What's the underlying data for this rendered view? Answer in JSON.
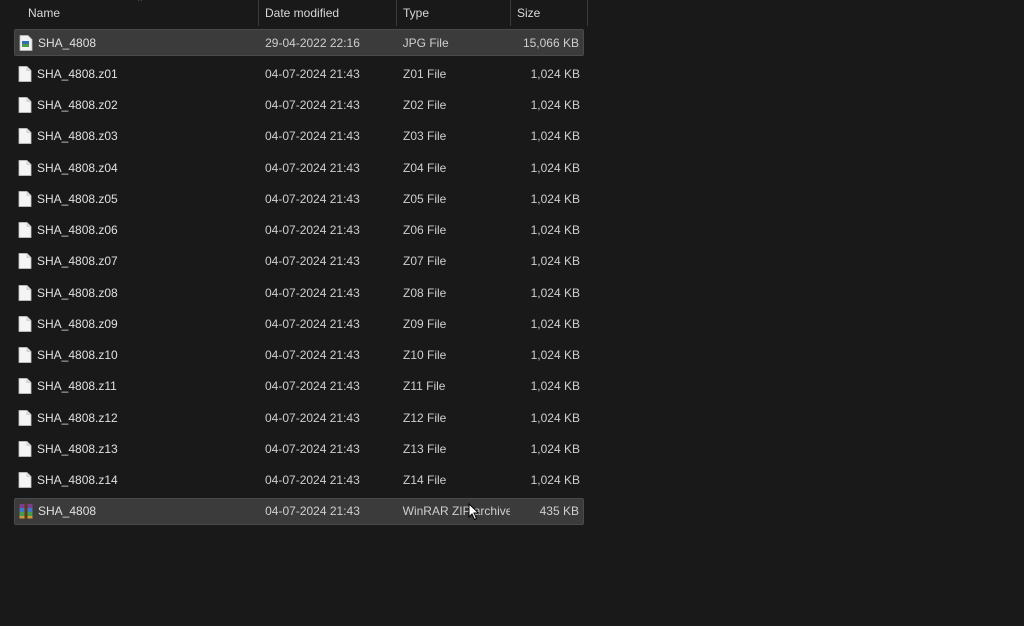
{
  "columns": {
    "name": "Name",
    "date": "Date modified",
    "type": "Type",
    "size": "Size"
  },
  "files": [
    {
      "name": "SHA_4808",
      "date": "29-04-2022 22:16",
      "type": "JPG File",
      "size": "15,066 KB",
      "icon": "image-file-icon",
      "selected": true
    },
    {
      "name": "SHA_4808.z01",
      "date": "04-07-2024 21:43",
      "type": "Z01 File",
      "size": "1,024 KB",
      "icon": "blank-file-icon",
      "selected": false
    },
    {
      "name": "SHA_4808.z02",
      "date": "04-07-2024 21:43",
      "type": "Z02 File",
      "size": "1,024 KB",
      "icon": "blank-file-icon",
      "selected": false
    },
    {
      "name": "SHA_4808.z03",
      "date": "04-07-2024 21:43",
      "type": "Z03 File",
      "size": "1,024 KB",
      "icon": "blank-file-icon",
      "selected": false
    },
    {
      "name": "SHA_4808.z04",
      "date": "04-07-2024 21:43",
      "type": "Z04 File",
      "size": "1,024 KB",
      "icon": "blank-file-icon",
      "selected": false
    },
    {
      "name": "SHA_4808.z05",
      "date": "04-07-2024 21:43",
      "type": "Z05 File",
      "size": "1,024 KB",
      "icon": "blank-file-icon",
      "selected": false
    },
    {
      "name": "SHA_4808.z06",
      "date": "04-07-2024 21:43",
      "type": "Z06 File",
      "size": "1,024 KB",
      "icon": "blank-file-icon",
      "selected": false
    },
    {
      "name": "SHA_4808.z07",
      "date": "04-07-2024 21:43",
      "type": "Z07 File",
      "size": "1,024 KB",
      "icon": "blank-file-icon",
      "selected": false
    },
    {
      "name": "SHA_4808.z08",
      "date": "04-07-2024 21:43",
      "type": "Z08 File",
      "size": "1,024 KB",
      "icon": "blank-file-icon",
      "selected": false
    },
    {
      "name": "SHA_4808.z09",
      "date": "04-07-2024 21:43",
      "type": "Z09 File",
      "size": "1,024 KB",
      "icon": "blank-file-icon",
      "selected": false
    },
    {
      "name": "SHA_4808.z10",
      "date": "04-07-2024 21:43",
      "type": "Z10 File",
      "size": "1,024 KB",
      "icon": "blank-file-icon",
      "selected": false
    },
    {
      "name": "SHA_4808.z11",
      "date": "04-07-2024 21:43",
      "type": "Z11 File",
      "size": "1,024 KB",
      "icon": "blank-file-icon",
      "selected": false
    },
    {
      "name": "SHA_4808.z12",
      "date": "04-07-2024 21:43",
      "type": "Z12 File",
      "size": "1,024 KB",
      "icon": "blank-file-icon",
      "selected": false
    },
    {
      "name": "SHA_4808.z13",
      "date": "04-07-2024 21:43",
      "type": "Z13 File",
      "size": "1,024 KB",
      "icon": "blank-file-icon",
      "selected": false
    },
    {
      "name": "SHA_4808.z14",
      "date": "04-07-2024 21:43",
      "type": "Z14 File",
      "size": "1,024 KB",
      "icon": "blank-file-icon",
      "selected": false
    },
    {
      "name": "SHA_4808",
      "date": "04-07-2024 21:43",
      "type": "WinRAR ZIP archive",
      "size": "435 KB",
      "icon": "winrar-archive-icon",
      "selected": true
    }
  ],
  "colors": {
    "background": "#191919",
    "selection": "#3b3b3b",
    "text": "#e0e0e0"
  }
}
